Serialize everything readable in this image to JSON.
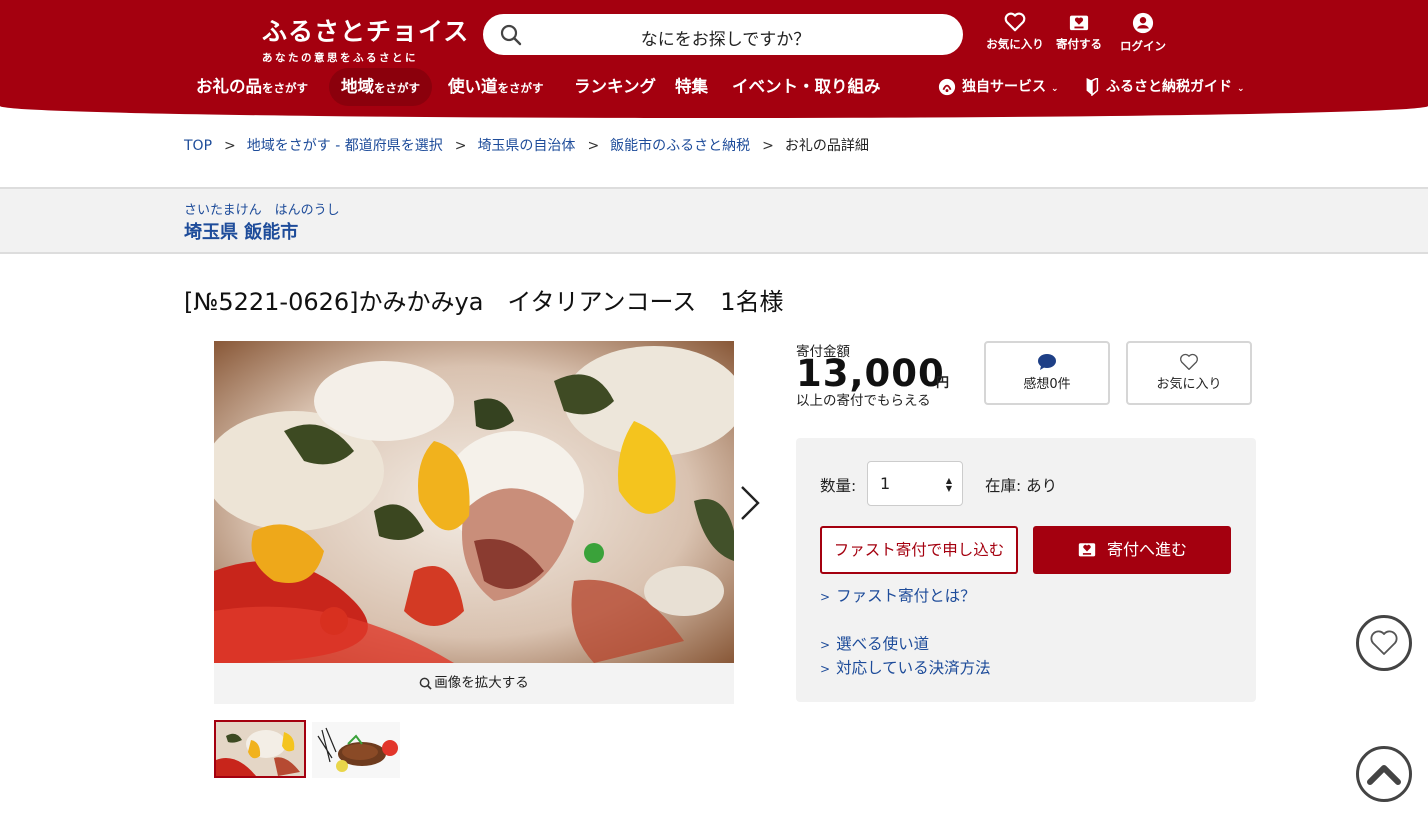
{
  "header": {
    "logo_main": "ふるさとチョイス",
    "logo_sub": "あなたの意思をふるさとに",
    "search_placeholder": "なにをお探しですか？",
    "icons": [
      {
        "name": "heart-icon",
        "label": "お気に入り"
      },
      {
        "name": "donate-icon",
        "label": "寄付する"
      },
      {
        "name": "user-icon",
        "label": "ログイン"
      }
    ]
  },
  "nav": {
    "items": [
      {
        "main": "お礼の品",
        "small": "をさがす"
      },
      {
        "main": "地域",
        "small": "をさがす"
      },
      {
        "main": "使い道",
        "small": "をさがす"
      },
      {
        "main": "ランキング",
        "small": ""
      },
      {
        "main": "特集",
        "small": ""
      },
      {
        "main": "イベント・取り組み",
        "small": ""
      }
    ],
    "right": [
      {
        "label": "独自サービス"
      },
      {
        "label": "ふるさと納税ガイド"
      }
    ]
  },
  "breadcrumb": {
    "items": [
      "TOP",
      "地域をさがす - 都道府県を選択",
      "埼玉県の自治体",
      "飯能市のふるさと納税"
    ],
    "current": "お礼の品詳細",
    "separator": ">"
  },
  "region": {
    "kana": "さいたまけん　はんのうし",
    "name": "埼玉県 飯能市"
  },
  "product": {
    "title": "[№5221-0626]かみかみya　イタリアンコース　1名様",
    "zoom_label": "画像を拡大する",
    "price_label": "寄付金額",
    "price": "13,000",
    "yen": "円",
    "price_note": "以上の寄付でもらえる",
    "review_label": "感想0件",
    "favorite_label": "お気に入り",
    "qty_label": "数量:",
    "qty_value": "1",
    "stock": "在庫:  あり",
    "fast_button": "ファスト寄付で申し込む",
    "donate_button": "寄付へ進む",
    "links": [
      "ファスト寄付とは？",
      "選べる使い道",
      "対応している決済方法"
    ]
  },
  "colors": {
    "brand": "#a4000f",
    "link": "#1e4c9a",
    "panel": "#f2f2f2"
  }
}
